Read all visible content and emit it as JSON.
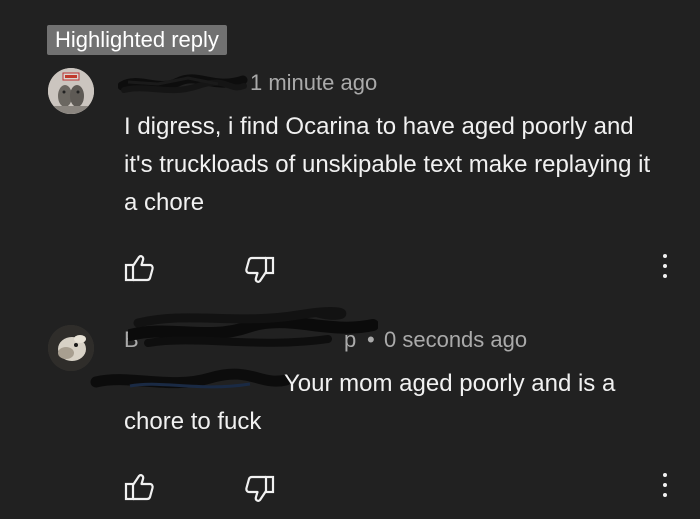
{
  "highlight_badge": "Highlighted reply",
  "comments": [
    {
      "author_obscured": true,
      "time": "1 minute ago",
      "text": "I digress, i find Ocarina to have aged poorly and it's truckloads of unskipable text make replaying it a chore"
    },
    {
      "author_partial": "B",
      "author_partial_end": "p",
      "separator": "•",
      "time": "0 seconds ago",
      "text": "Your mom aged poorly and is a chore to fuck"
    }
  ],
  "actions": {
    "like_icon": "thumbs-up-icon",
    "dislike_icon": "thumbs-down-icon",
    "more_icon": "more-vertical-icon"
  },
  "colors": {
    "background": "#212121",
    "text": "#f1f1f1",
    "secondary": "#aaaaaa",
    "badge": "#717171"
  }
}
